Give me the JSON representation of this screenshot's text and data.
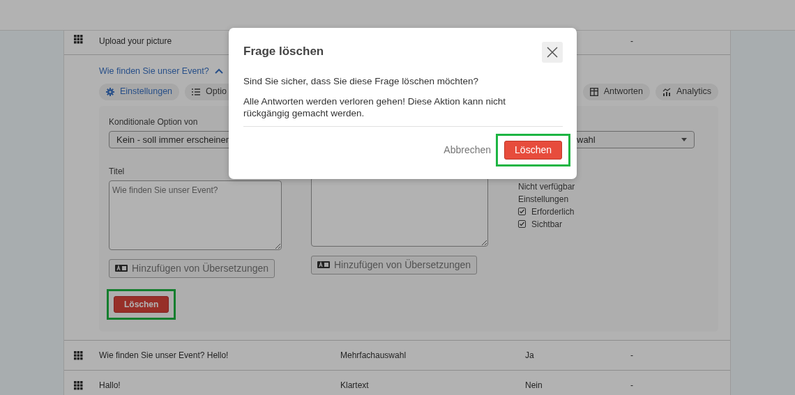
{
  "rows_above": [
    {
      "text": "Upload your picture",
      "column_4": "-"
    }
  ],
  "expanded_question": {
    "title_link": "Wie finden Sie unser Event?",
    "expanded": true,
    "tabs": [
      {
        "label": "Einstellungen",
        "selected": true,
        "kind": "settings"
      },
      {
        "label": "Optio",
        "selected": false,
        "kind": "options"
      },
      {
        "label": "Antworten",
        "selected": false,
        "kind": "answers"
      },
      {
        "label": "Analytics",
        "selected": false,
        "kind": "analytics"
      }
    ],
    "conditional_label": "Konditionale Option von",
    "conditional_select": "Kein - soll immer erscheinen",
    "type_select": "wahl",
    "title_label": "Titel",
    "title_placeholder": "Wie finden Sie unser Event?",
    "translation_buttons": [
      "Hinzufügen von Übersetzungen",
      "Hinzufügen von Übersetzungen"
    ],
    "availability": "Nicht verfügbar",
    "settings_label": "Einstellungen",
    "settings": [
      {
        "label": "Erforderlich",
        "checked": true
      },
      {
        "label": "Sichtbar",
        "checked": true
      }
    ],
    "delete_button": {
      "label": "Löschen",
      "highlighted": true
    }
  },
  "rows_below": [
    {
      "text": "Wie finden Sie unser Event? Hello!",
      "column_2": "Mehrfachauswahl",
      "column_3": "Ja",
      "column_4": "-"
    },
    {
      "text": "Hallo!",
      "column_2": "Klartext",
      "column_3": "Nein",
      "column_4": "-"
    }
  ],
  "dialog": {
    "title": "Frage löschen",
    "message": "Sind Sie sicher, dass Sie diese Frage löschen möchten?",
    "warning": "Alle Antworten werden verloren gehen! Diese Aktion kann nicht rückgängig gemacht werden.",
    "cancel": "Abbrechen",
    "confirm": {
      "label": "Löschen",
      "highlighted": true
    }
  }
}
